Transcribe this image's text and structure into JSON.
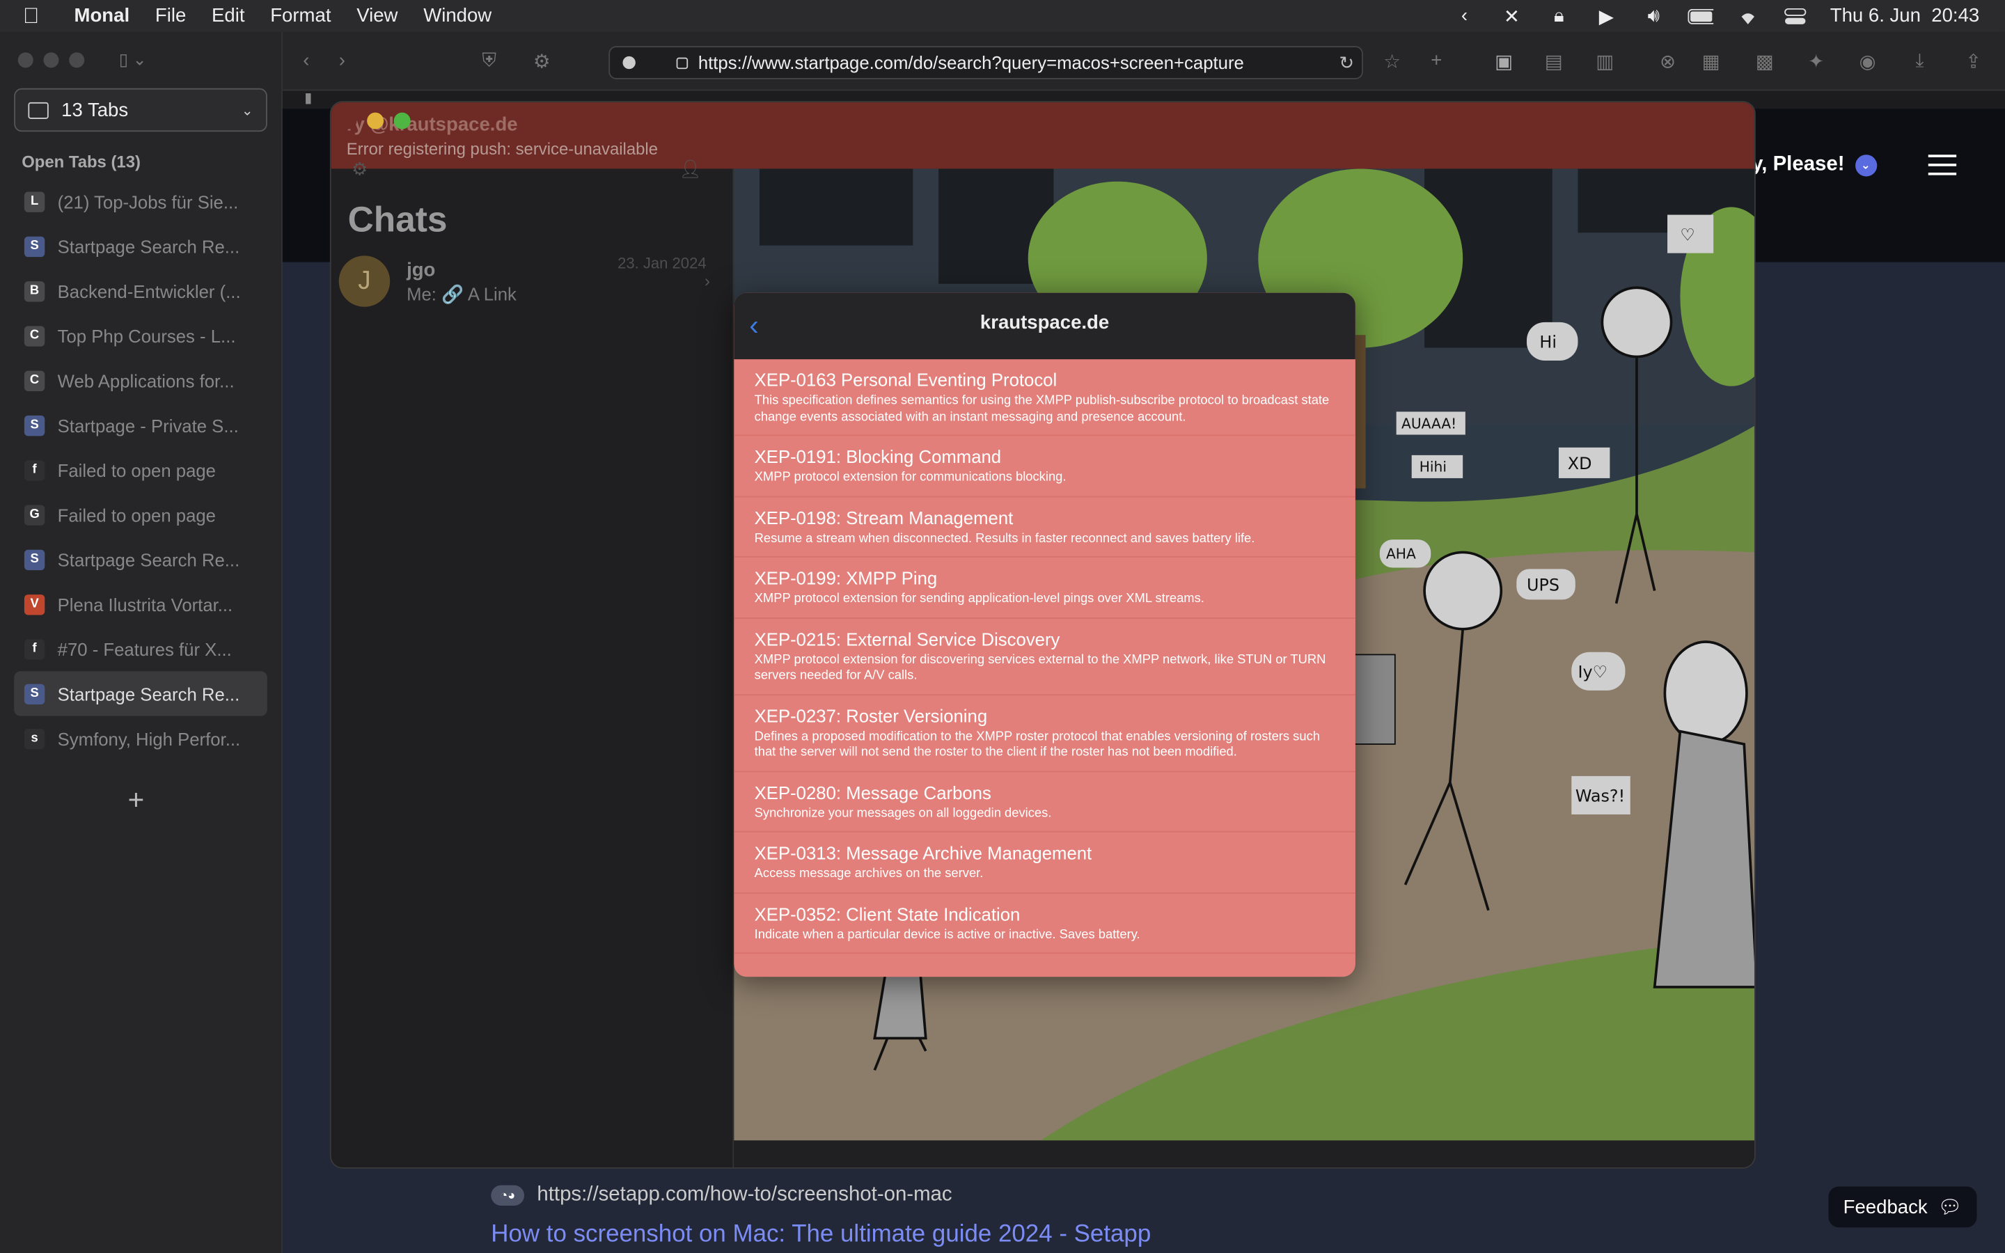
{
  "menubar": {
    "app": "Monal",
    "items": [
      "File",
      "Edit",
      "Format",
      "View",
      "Window"
    ],
    "datetime": "Thu 6. Jun  20:43"
  },
  "sidebar": {
    "tab_selector": "13 Tabs",
    "open_tabs_heading": "Open Tabs (13)",
    "tabs": [
      {
        "label": "(21) Top-Jobs für Sie...",
        "fav": "L",
        "color": "#4a4a4c"
      },
      {
        "label": "Startpage Search Re...",
        "fav": "S",
        "color": "#4a5a8a"
      },
      {
        "label": "Backend-Entwickler (...",
        "fav": "B",
        "color": "#4a4a4c"
      },
      {
        "label": "Top Php Courses - L...",
        "fav": "C",
        "color": "#4a4a4c"
      },
      {
        "label": "Web Applications for...",
        "fav": "C",
        "color": "#4a4a4c"
      },
      {
        "label": "Startpage - Private S...",
        "fav": "S",
        "color": "#4a5a8a"
      },
      {
        "label": "Failed to open page",
        "fav": "f",
        "color": "#2f2f31"
      },
      {
        "label": "Failed to open page",
        "fav": "G",
        "color": "#3a3a3c"
      },
      {
        "label": "Startpage Search Re...",
        "fav": "S",
        "color": "#4a5a8a"
      },
      {
        "label": "Plena Ilustrita Vortar...",
        "fav": "V",
        "color": "#c0462e"
      },
      {
        "label": "#70 - Features für X...",
        "fav": "f",
        "color": "#2f2f31"
      },
      {
        "label": "Startpage Search Re...",
        "fav": "S",
        "color": "#4a5a8a",
        "active": true
      },
      {
        "label": "Symfony, High Perfor...",
        "fav": "s",
        "color": "#2f2f31"
      }
    ]
  },
  "toolbar": {
    "url": "https://www.startpage.com/do/search?query=macos+screen+capture"
  },
  "page": {
    "privacy_label": "cy, Please!",
    "result_url": "https://setapp.com/how-to/screenshot-on-mac",
    "result_title": "How to screenshot on Mac: The ultimate guide 2024 - Setapp",
    "feedback_label": "Feedback"
  },
  "monal": {
    "account": "ry @krautspace.de",
    "error": "Error registering push: service-unavailable",
    "chats_title": "Chats",
    "chat": {
      "avatar": "J",
      "name": "jgo",
      "preview": "Me: 🔗 A Link",
      "date": "23. Jan 2024"
    }
  },
  "modal": {
    "title": "krautspace.de",
    "xeps": [
      {
        "title": "XEP-0163 Personal Eventing Protocol",
        "desc": "This specification defines semantics for using the XMPP publish-subscribe protocol to broadcast state change events associated with an instant messaging and presence account."
      },
      {
        "title": "XEP-0191: Blocking Command",
        "desc": "XMPP protocol extension for communications blocking."
      },
      {
        "title": "XEP-0198: Stream Management",
        "desc": "Resume a stream when disconnected. Results in faster reconnect and saves battery life."
      },
      {
        "title": "XEP-0199: XMPP Ping",
        "desc": "XMPP protocol extension for sending application-level pings over XML streams."
      },
      {
        "title": "XEP-0215: External Service Discovery",
        "desc": "XMPP protocol extension for discovering services external to the XMPP network, like STUN or TURN servers needed for A/V calls."
      },
      {
        "title": "XEP-0237: Roster Versioning",
        "desc": "Defines a proposed modification to the XMPP roster protocol that enables versioning of rosters such that the server will not send the roster to the client if the roster has not been modified."
      },
      {
        "title": "XEP-0280: Message Carbons",
        "desc": "Synchronize your messages on all loggedin devices."
      },
      {
        "title": "XEP-0313: Message Archive Management",
        "desc": "Access message archives on the server."
      },
      {
        "title": "XEP-0352: Client State Indication",
        "desc": "Indicate when a particular device is active or inactive. Saves battery."
      }
    ]
  },
  "illustration": {
    "bubbles": [
      "Hi",
      "AUAAA!",
      "Hihi",
      "XD",
      "AHA",
      "UPS",
      "Iy♡",
      "Was?!"
    ]
  }
}
